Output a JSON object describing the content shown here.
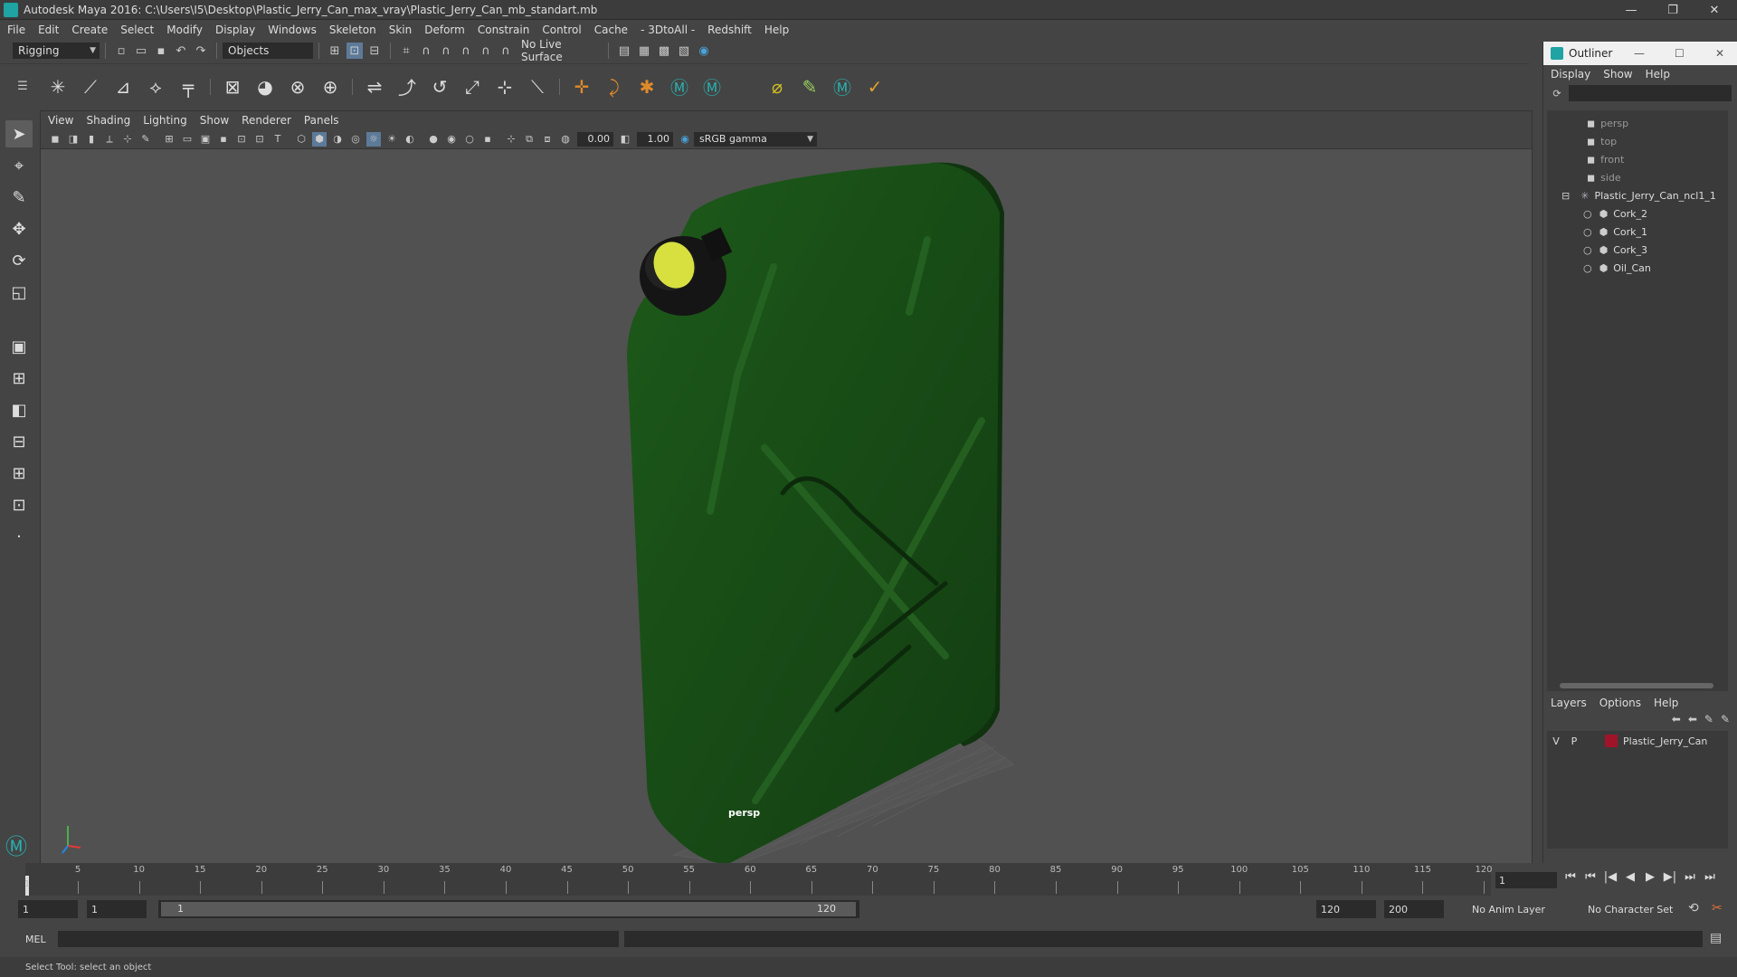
{
  "window": {
    "title": "Autodesk Maya 2016: C:\\Users\\I5\\Desktop\\Plastic_Jerry_Can_max_vray\\Plastic_Jerry_Can_mb_standart.mb",
    "minimize": "—",
    "restore": "❐",
    "close": "✕"
  },
  "menubar": [
    "File",
    "Edit",
    "Create",
    "Select",
    "Modify",
    "Display",
    "Windows",
    "Skeleton",
    "Skin",
    "Deform",
    "Constrain",
    "Control",
    "Cache",
    "- 3DtoAll -",
    "Redshift",
    "Help"
  ],
  "statusline": {
    "mode": "Rigging",
    "select_mode": "Objects",
    "live_surface": "No Live Surface"
  },
  "viewport": {
    "menu": [
      "View",
      "Shading",
      "Lighting",
      "Show",
      "Renderer",
      "Panels"
    ],
    "exposure": "0.00",
    "gamma": "1.00",
    "color_space": "sRGB gamma",
    "camera_label": "persp",
    "object_color": "#1f4f1a",
    "cap_color": "#d8e040"
  },
  "outliner": {
    "title": "Outliner",
    "menu": [
      "Display",
      "Show",
      "Help"
    ],
    "items": [
      {
        "label": "persp",
        "icon": "camera-icon",
        "dim": true
      },
      {
        "label": "top",
        "icon": "camera-icon",
        "dim": true
      },
      {
        "label": "front",
        "icon": "camera-icon",
        "dim": true
      },
      {
        "label": "side",
        "icon": "camera-icon",
        "dim": true
      },
      {
        "label": "Plastic_Jerry_Can_ncl1_1",
        "icon": "group-icon",
        "dim": false
      },
      {
        "label": "Cork_2",
        "icon": "mesh-icon",
        "dim": false
      },
      {
        "label": "Cork_1",
        "icon": "mesh-icon",
        "dim": false
      },
      {
        "label": "Cork_3",
        "icon": "mesh-icon",
        "dim": false
      },
      {
        "label": "Oil_Can",
        "icon": "mesh-icon",
        "dim": false
      }
    ]
  },
  "layers": {
    "menu": [
      "Layers",
      "Options",
      "Help"
    ],
    "rows": [
      {
        "v": "V",
        "p": "P",
        "name": "Plastic_Jerry_Can",
        "color": "#a0142a"
      }
    ]
  },
  "timeline": {
    "ticks": [
      5,
      10,
      15,
      20,
      25,
      30,
      35,
      40,
      45,
      50,
      55,
      60,
      65,
      70,
      75,
      80,
      85,
      90,
      95,
      100,
      105,
      110,
      115,
      120
    ],
    "first_label": "1",
    "current_frame": "1"
  },
  "range": {
    "start": "1",
    "anim_start": "1",
    "slider_start": "1",
    "slider_end": "120",
    "anim_end": "120",
    "end": "200",
    "anim_layer": "No Anim Layer",
    "character_set": "No Character Set"
  },
  "cmdline": {
    "label": "MEL"
  },
  "helpline": {
    "text": "Select Tool: select an object"
  }
}
